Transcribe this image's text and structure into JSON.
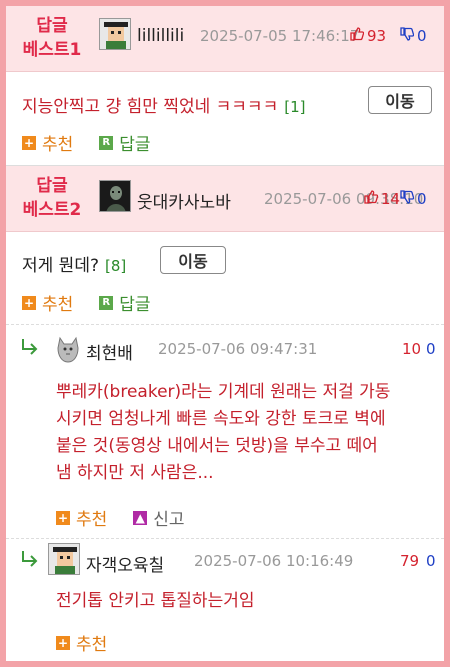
{
  "move_label": "이동",
  "recommend_label": "추천",
  "reply_label": "답글",
  "report_label": "신고",
  "best": [
    {
      "label_line1": "답글",
      "label_line2": "베스트1",
      "nickname": "lillillili",
      "date": "2025-07-05 17:46:17",
      "up": "93",
      "down": "0",
      "content": "지능안찍고 걍 힘만 찍었네 ㅋㅋㅋㅋ",
      "reply_count": "[1]"
    },
    {
      "label_line1": "답글",
      "label_line2": "베스트2",
      "nickname": "웃대카사노바",
      "date": "2025-07-06 09:38:10",
      "up": "14",
      "down": "0",
      "content": "저게 뭔데?",
      "reply_count": "[8]"
    }
  ],
  "replies": [
    {
      "nickname": "최현배",
      "date": "2025-07-06 09:47:31",
      "up": "10",
      "down": "0",
      "lines": [
        "뿌레카(breaker)라는 기계데 원래는 저걸 가동",
        "시키면 엄청나게 빠른 속도와 강한 토크로 벽에",
        "붙은 것(동영상 내에서는 덧방)을 부수고 떼어",
        "냄 하지만 저 사람은..."
      ]
    },
    {
      "nickname": "자객오육칠",
      "date": "2025-07-06 10:16:49",
      "up": "79",
      "down": "0",
      "lines": [
        "전기톱 안키고 톱질하는거임"
      ]
    }
  ],
  "colors": {
    "best_bg": "#fde4e6",
    "best_label": "#e02a4a",
    "content_red": "#c4202c",
    "upvote": "#d4232f",
    "downvote": "#1f3fc5",
    "border": "#f3a3a8"
  }
}
